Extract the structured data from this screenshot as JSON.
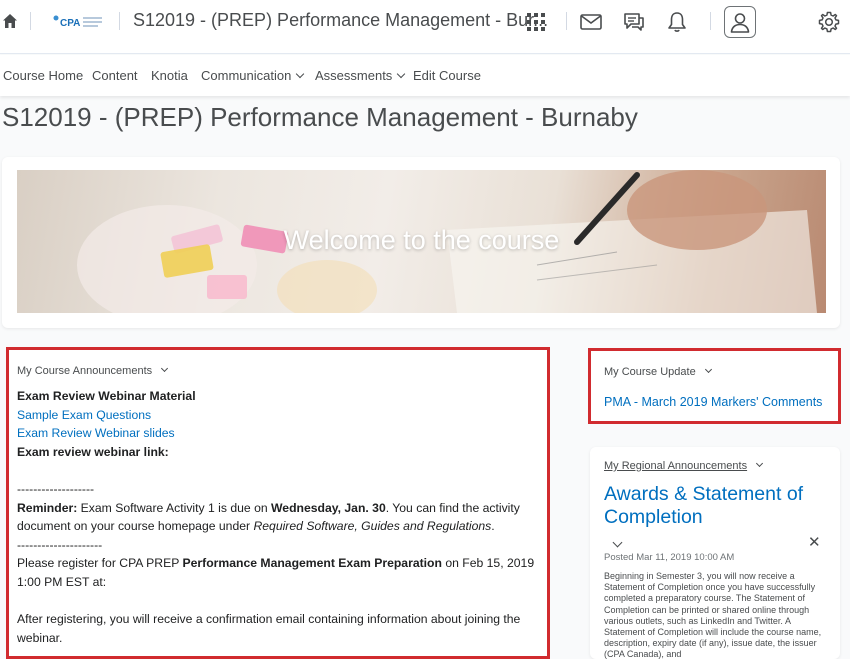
{
  "header": {
    "course_title": "S12019 - (PREP) Performance Management - Bur...",
    "logo_text": "CPA"
  },
  "nav": {
    "items": [
      {
        "label": "Course Home"
      },
      {
        "label": "Content"
      },
      {
        "label": "Knotia"
      },
      {
        "label": "Communication"
      },
      {
        "label": "Assessments"
      },
      {
        "label": "Edit Course"
      }
    ]
  },
  "page": {
    "title": "S12019 - (PREP) Performance Management - Burnaby"
  },
  "banner": {
    "text": "Welcome to the course"
  },
  "announcements": {
    "heading": "My Course Announcements",
    "title": "Exam Review Webinar Material",
    "link1": "Sample Exam Questions",
    "link2": "Exam Review Webinar slides",
    "webinar_label": "Exam review webinar link:",
    "sep": "-------------------",
    "reminder_label": "Reminder:",
    "reminder_text1": " Exam Software Activity 1 is due on ",
    "reminder_date": "Wednesday, Jan. 30",
    "reminder_text2": ". You can find the activity",
    "reminder_line2a": "document on your course homepage under ",
    "reminder_line2b": "Required Software, Guides and Regulations",
    "reminder_line2c": ".",
    "sep2": "---------------------",
    "register_text1": "Please register for CPA PREP ",
    "register_bold": "Performance Management Exam Preparation",
    "register_text2": " on Feb 15, 2019",
    "register_line2": "1:00 PM EST at:",
    "after_line1": "After registering, you will receive a confirmation email containing information about joining the",
    "after_line2": "webinar."
  },
  "course_update": {
    "heading": "My Course Update",
    "link": "PMA - March 2019 Markers' Comments"
  },
  "regional": {
    "heading": "My Regional Announcements",
    "title": "Awards & Statement of Completion",
    "posted": "Posted Mar 11, 2019 10:00 AM",
    "body": "Beginning in Semester 3, you will now receive a Statement of Completion once you have successfully completed a preparatory course. The Statement of Completion can be printed or shared online through various outlets, such as LinkedIn and Twitter. A Statement of Completion will include the course name, description, expiry date (if any), issue date, the issuer (CPA Canada), and"
  },
  "colors": {
    "link": "#006fbf",
    "highlight_outline": "#d12b2f",
    "text": "#494c4e"
  },
  "icons": [
    "home-icon",
    "cpa-logo",
    "waffle-icon",
    "mail-icon",
    "chat-icon",
    "bell-icon",
    "user-avatar-icon",
    "gear-icon",
    "chevron-down-icon",
    "close-icon"
  ]
}
